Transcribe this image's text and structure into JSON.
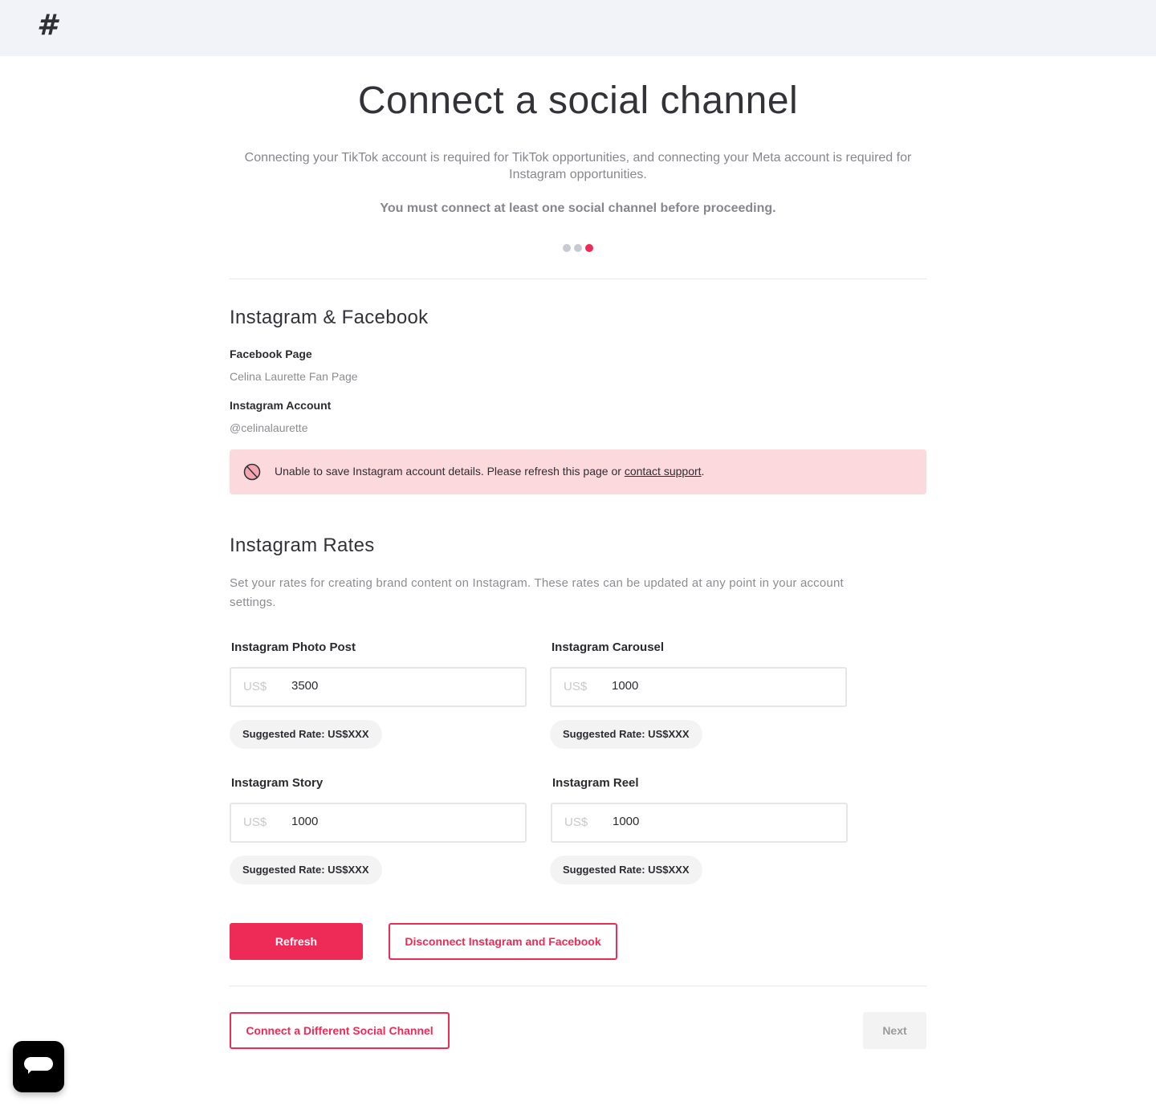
{
  "header": {
    "logo_glyph": "#",
    "logo_label": "Home"
  },
  "page": {
    "title": "Connect a social channel",
    "intro": "Connecting your TikTok account is required for TikTok opportunities, and connecting your Meta account is required for Instagram opportunities.",
    "required_notice": "You must connect at least one social channel before proceeding.",
    "steps": {
      "total": 3,
      "current": 3
    }
  },
  "connection": {
    "title": "Instagram & Facebook",
    "facebook_label": "Facebook Page",
    "facebook_value": "Celina Laurette Fan Page",
    "instagram_label": "Instagram Account",
    "instagram_value": "@celinalaurette"
  },
  "alert": {
    "icon": "prohibited-icon",
    "message": "Unable to save Instagram account details. Please refresh this page or ",
    "link_text": "contact support",
    "suffix": "."
  },
  "rates": {
    "title": "Instagram Rates",
    "description": "Set your rates for creating brand content on Instagram. These rates can be updated at any point in your account settings.",
    "currency": "US$",
    "items": [
      {
        "label": "Instagram Photo Post",
        "value": "3500",
        "suggested": "Suggested Rate: US$XXX"
      },
      {
        "label": "Instagram Carousel",
        "value": "1000",
        "suggested": "Suggested Rate: US$XXX"
      },
      {
        "label": "Instagram Story",
        "value": "1000",
        "suggested": "Suggested Rate: US$XXX"
      },
      {
        "label": "Instagram Reel",
        "value": "1000",
        "suggested": "Suggested Rate: US$XXX"
      }
    ]
  },
  "actions": {
    "refresh": "Refresh",
    "disconnect": "Disconnect Instagram and Facebook",
    "connect_different": "Connect a Different Social Channel",
    "next": "Next"
  },
  "colors": {
    "accent": "#ee2a56",
    "alert_bg": "#fbd9dd",
    "topbar_bg": "#f2f3f8"
  },
  "chat": {
    "icon": "chat-icon"
  }
}
